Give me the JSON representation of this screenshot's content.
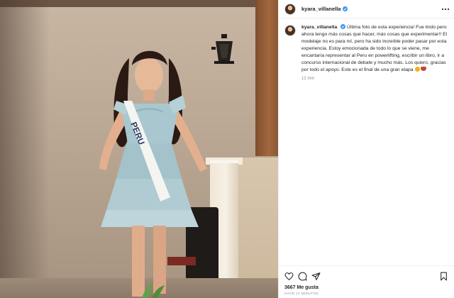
{
  "post": {
    "author": {
      "username": "kyara_villanella",
      "verified": true,
      "verified_icon": "verified-badge-icon",
      "avatar_icon": "profile-avatar"
    },
    "photo": {
      "sash_text": "PERU"
    },
    "caption": {
      "username": "kyara_villanella",
      "text": "Última foto de esta experiencia! Fue lindo pero ahora tengo más cosas que hacer, más cosas que experimentar!! El modelaje no es para mí, pero ha sido increíble poder pasar por esta experiencia. Estoy emocionada de todo lo que se viene, me encantaría representar al Peru en powerlifting, escribir un libro, ir a concurso internacional de debate y mucho más. Los quiero, gracias por todo el apoyo. Este es el final de una gran etapa",
      "time_ago": "12 min"
    },
    "actions": {
      "like_icon": "heart-icon",
      "comment_icon": "comment-icon",
      "share_icon": "share-icon",
      "save_icon": "bookmark-icon"
    },
    "likes_text": "3667 Me gusta",
    "posted_text": "HACE 12 MINUTOS",
    "colors": {
      "verified": "#3897f0",
      "text": "#262626",
      "muted": "#8e8e8e",
      "dress": "#a9c7cf",
      "sash": "#f4f4f0"
    }
  }
}
